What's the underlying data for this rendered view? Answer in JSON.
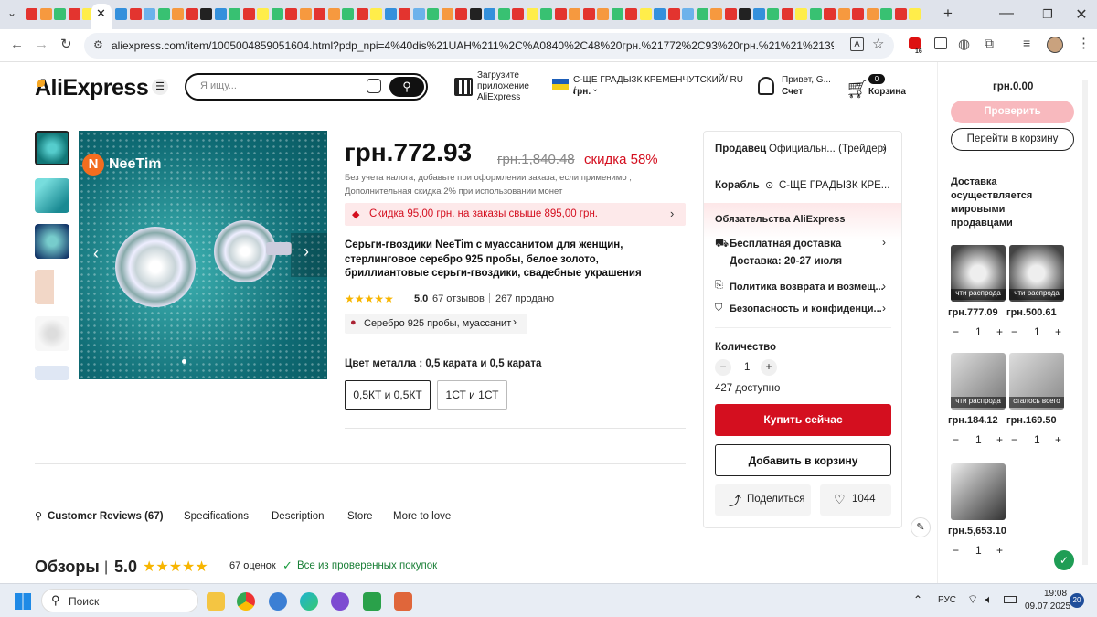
{
  "browser": {
    "url": "aliexpress.com/item/1005004859051604.html?pdp_npi=4%40dis%21UAH%211%2C%A0840%2C48%20грн.%21772%2C93%20грн.%21%21%2139.98%2116.79%21...",
    "extensions_badge": "16"
  },
  "header": {
    "logo": "AliExpress",
    "search_placeholder": "Я ищу...",
    "app_promo": "Загрузите приложение AliExpress",
    "region": "С-ЩЕ ГРАДЫЗК КРЕМЕНЧУТСКИЙ/ RU /",
    "currency": "грн.",
    "greeting": "Привет, G...",
    "account": "Счет",
    "cart_count": "0",
    "cart_label": "Корзина"
  },
  "gallery": {
    "brand": "NeeTim"
  },
  "product": {
    "price": "грн.772.93",
    "old_price": "грн.1,840.48",
    "discount": "скидка 58%",
    "tax_note": "Без учета налога, добавьте при оформлении заказа, если применимо ;",
    "extra_discount": "Дополнительная скидка 2% при использовании монет",
    "coupon": "Скидка 95,00 грн. на заказы свыше 895,00 грн.",
    "title": "Серьги-гвоздики NeeTim с муассанитом для женщин, стерлинговое серебро 925 пробы, белое золото, бриллиантовые серьги-гвоздики, свадебные украшения",
    "rating": "5.0",
    "reviews": "67 отзывов",
    "sold": "267 продано",
    "tag": "Серебро 925 пробы, муассанит",
    "option_label": "Цвет металла : 0,5 карата и 0,5 карата",
    "options": [
      "0,5КТ и 0,5КТ",
      "1СТ и 1СТ"
    ]
  },
  "tabs": [
    "Customer Reviews (67)",
    "Specifications",
    "Description",
    "Store",
    "More to love"
  ],
  "reviews_section": {
    "title": "Обзоры",
    "score": "5.0",
    "count": "67 оценок",
    "verified": "Все из проверенных покупок"
  },
  "buybox": {
    "seller_label": "Продавец",
    "seller_value": "Официальн... (Трейдер)",
    "ship_label": "Корабль",
    "ship_value": "С-ЩЕ ГРАДЫЗК КРЕ...",
    "commitment": "Обязательства AliExpress",
    "free_shipping": "Бесплатная доставка",
    "delivery": "Доставка: 20-27 июля",
    "returns": "Политика возврата и возмещ...",
    "privacy": "Безопасность и конфиденци...",
    "quantity_label": "Количество",
    "quantity": "1",
    "available": "427 доступно",
    "buy_now": "Купить сейчас",
    "add_to_cart": "Добавить в корзину",
    "share": "Поделиться",
    "likes": "1044"
  },
  "sidecart": {
    "total": "грн.0.00",
    "check": "Проверить",
    "go_to_cart": "Перейти в корзину",
    "shipping_note": "Доставка осуществляется мировыми продавцами",
    "items": [
      {
        "price": "грн.777.09",
        "qty": "1",
        "caption": "чти распрода"
      },
      {
        "price": "грн.500.61",
        "qty": "1",
        "caption": "чти распрода"
      },
      {
        "price": "грн.184.12",
        "qty": "1",
        "caption": "чти распрода"
      },
      {
        "price": "грн.169.50",
        "qty": "1",
        "caption": "сталось всего"
      },
      {
        "price": "грн.5,653.10",
        "qty": "1",
        "caption": ""
      }
    ]
  },
  "taskbar": {
    "search": "Поиск",
    "lang": "РУС",
    "time": "19:08",
    "date": "09.07.2025",
    "notif": "20"
  },
  "colors": {
    "brand_red": "#d40f1f",
    "price_red": "#e62e04",
    "star": "#f7b500",
    "teal": "#17858c"
  }
}
